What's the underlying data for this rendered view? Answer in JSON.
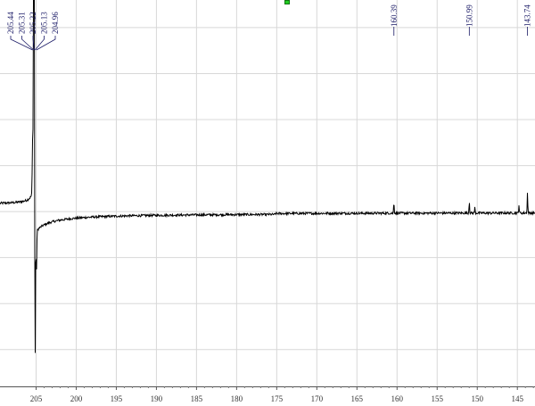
{
  "chart_data": {
    "type": "line",
    "title": "",
    "xlabel": "",
    "ylabel": "",
    "x_axis": {
      "reversed": true,
      "xlim": [
        209.5,
        142.8
      ],
      "ticks": [
        205,
        200,
        195,
        190,
        185,
        180,
        175,
        170,
        165,
        160,
        155,
        150,
        145
      ],
      "tick_labels": [
        "205",
        "200",
        "195",
        "190",
        "185",
        "180",
        "175",
        "170",
        "165",
        "160",
        "155",
        "150",
        "145"
      ]
    },
    "y_axis": {
      "visible": false,
      "ylim": [
        -1.9,
        2.3
      ]
    },
    "grid": true,
    "baseline": 0,
    "peaks": [
      {
        "label": "205.44",
        "x": 205.44,
        "y": 0.55
      },
      {
        "label": "205.31",
        "x": 205.31,
        "y": 2.2
      },
      {
        "label": "205.22",
        "x": 205.22,
        "y": 2.05
      },
      {
        "label": "205.13",
        "x": 205.13,
        "y": -1.55
      },
      {
        "label": "204.96",
        "x": 204.96,
        "y": -0.45
      },
      {
        "label": "160.39",
        "x": 160.39,
        "y": 0.12
      },
      {
        "label": "150.99",
        "x": 150.99,
        "y": 0.13
      },
      {
        "label": "143.74",
        "x": 143.74,
        "y": 0.22
      }
    ],
    "minor_peaks": [
      {
        "x": 150.3,
        "y": 0.06
      },
      {
        "x": 144.8,
        "y": 0.09
      }
    ],
    "dispersive_feature": {
      "center": 205.2,
      "pre_level": 0.08,
      "post_level": -0.12
    }
  },
  "colors": {
    "trace": "#000000",
    "grid": "#d8d8d8",
    "peak_label": "#1a1a66",
    "marker": "#22cc22"
  },
  "icons": {
    "top_marker": "green-square-marker"
  }
}
